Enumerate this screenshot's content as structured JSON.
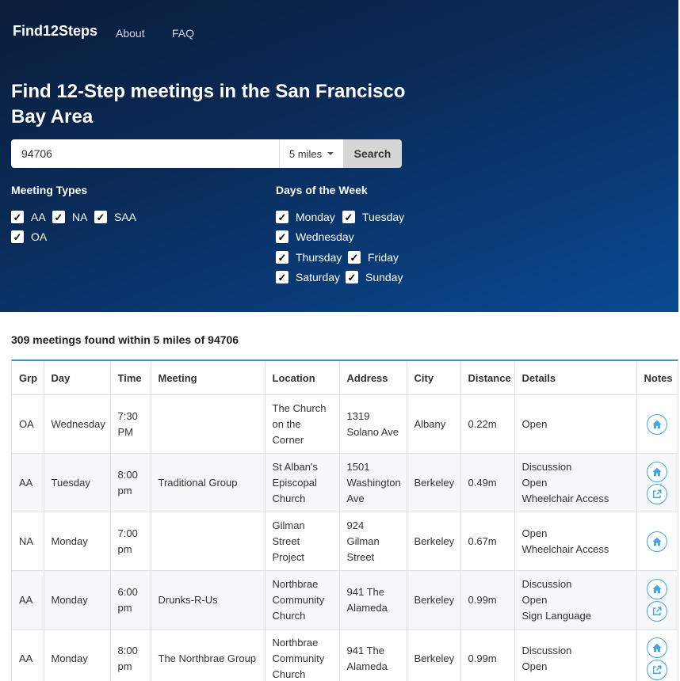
{
  "nav": {
    "brand": "Find12Steps",
    "about": "About",
    "faq": "FAQ"
  },
  "headline": "Find 12-Step meetings in the San Francisco Bay Area",
  "search": {
    "value": "94706",
    "radius": "5 miles",
    "button": "Search"
  },
  "filters": {
    "types_title": "Meeting Types",
    "types": [
      "AA",
      "NA",
      "SAA",
      "OA"
    ],
    "days_title": "Days of the Week",
    "days": [
      "Monday",
      "Tuesday",
      "Wednesday",
      "Thursday",
      "Friday",
      "Saturday",
      "Sunday"
    ]
  },
  "results": {
    "summary": "309 meetings found within 5 miles of 94706",
    "columns": [
      "Grp",
      "Day",
      "Time",
      "Meeting",
      "Location",
      "Address",
      "City",
      "Distance",
      "Details",
      "Notes"
    ],
    "rows": [
      {
        "grp": "OA",
        "day": "Wednesday",
        "time": "7:30 PM",
        "meeting": "",
        "location": "The Church on the Corner",
        "address": "1319 Solano Ave",
        "city": "Albany",
        "distance": "0.22m",
        "details": [
          "Open"
        ],
        "notes": [
          "home-icon"
        ]
      },
      {
        "grp": "AA",
        "day": "Tuesday",
        "time": "8:00 pm",
        "meeting": "Traditional Group",
        "location": "St Alban's Episcopal Church",
        "address": "1501 Washington Ave",
        "city": "Berkeley",
        "distance": "0.49m",
        "details": [
          "Discussion",
          "Open",
          "Wheelchair Access"
        ],
        "notes": [
          "home-icon",
          "external-link-icon"
        ]
      },
      {
        "grp": "NA",
        "day": "Monday",
        "time": "7:00 pm",
        "meeting": "",
        "location": "Gilman Street Project",
        "address": "924 Gilman Street",
        "city": "Berkeley",
        "distance": "0.67m",
        "details": [
          "Open",
          "Wheelchair Access"
        ],
        "notes": [
          "home-icon"
        ]
      },
      {
        "grp": "AA",
        "day": "Monday",
        "time": "6:00 pm",
        "meeting": "Drunks-R-Us",
        "location": "Northbrae Community Church",
        "address": "941 The Alameda",
        "city": "Berkeley",
        "distance": "0.99m",
        "details": [
          "Discussion",
          "Open",
          "Sign Language"
        ],
        "notes": [
          "home-icon",
          "external-link-icon"
        ]
      },
      {
        "grp": "AA",
        "day": "Monday",
        "time": "8:00 pm",
        "meeting": "The Northbrae Group",
        "location": "Northbrae Community Church",
        "address": "941 The Alameda",
        "city": "Berkeley",
        "distance": "0.99m",
        "details": [
          "Discussion",
          "Open"
        ],
        "notes": [
          "home-icon",
          "external-link-icon"
        ]
      }
    ]
  },
  "colors": {
    "accent": "#3fa6e0",
    "hero_dark": "#0b1d3a",
    "hero_light": "#0a4a92"
  }
}
